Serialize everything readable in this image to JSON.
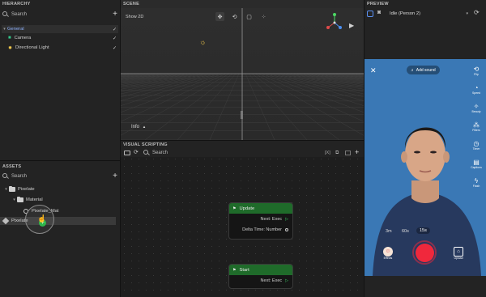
{
  "hierarchy": {
    "title": "HIERARCHY",
    "search_placeholder": "Search",
    "group": "General",
    "items": [
      {
        "label": "Camera",
        "icon": "camera-icon"
      },
      {
        "label": "Directional Light",
        "icon": "light-icon"
      }
    ]
  },
  "assets": {
    "title": "ASSETS",
    "search_placeholder": "Search",
    "folder_root": "Pixelate",
    "folder_child": "Material",
    "material_file": "Pixelate_Mat",
    "dragged_item": "Pixelate"
  },
  "scene": {
    "title": "SCENE",
    "mode_label": "Show 2D",
    "info_label": "Info"
  },
  "visual_scripting": {
    "title": "VISUAL SCRIPTING",
    "search_placeholder": "Search",
    "nodes": [
      {
        "title": "Update",
        "rows": [
          "Next: Exec",
          "Delta Time: Number"
        ]
      },
      {
        "title": "Start",
        "rows": [
          "Next: Exec"
        ]
      }
    ]
  },
  "preview": {
    "title": "PREVIEW",
    "selected_preset": "Idle (Person 2)",
    "add_sound": "Add sound",
    "durations": [
      "3m",
      "60s",
      "15s"
    ],
    "selected_duration": "15s",
    "effects_label": "Effects",
    "upload_label": "Upload",
    "side_labels": [
      "Flip",
      "Speed",
      "Beauty",
      "Filters",
      "Timer",
      "Captions",
      "Flash"
    ]
  },
  "colors": {
    "accent_green": "#1f6b2a",
    "record_red": "#f0283c",
    "preview_bg": "#3a78b5"
  }
}
